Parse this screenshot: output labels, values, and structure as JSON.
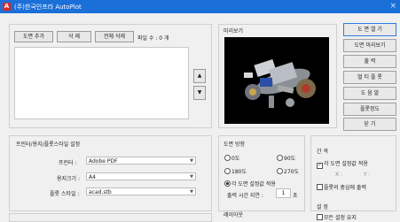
{
  "window": {
    "icon_glyph": "A",
    "title": "(주)한국인프라 AutoPlot",
    "close_glyph": "×"
  },
  "file_panel": {
    "add_label": "도면 추가",
    "delete_label": "삭 제",
    "delete_all_label": "전체 삭제",
    "file_count_label": "파일 수 : 0 개",
    "up_arrow": "▲",
    "down_arrow": "▼"
  },
  "preview": {
    "label": "미리보기"
  },
  "side_buttons": [
    {
      "label": "도 면 열 기"
    },
    {
      "label": "도면 미리보기"
    },
    {
      "label": "출  력"
    },
    {
      "label": "멀 티 플 롯"
    },
    {
      "label": "도 움 말"
    },
    {
      "label": "플롯정도"
    },
    {
      "label": "닫  기"
    }
  ],
  "printer_group": {
    "title": "프린터/용지/플롯스타일 설정",
    "printer_label": "프린터 :",
    "printer_value": "Adobe PDF",
    "paper_label": "용지크기 :",
    "paper_value": "A4",
    "style_label": "플롯 스타일 :",
    "style_value": "acad.stb"
  },
  "direction_group": {
    "title": "도면 방향",
    "opt_0": "0도",
    "opt_90": "90도",
    "opt_180": "180도",
    "opt_270": "270도",
    "opt_auto": "각 도면 설정값 적용",
    "delay_label": "출력 시간 지연 :",
    "delay_value": "1",
    "delay_unit": "초",
    "layout_label": "레이아웃"
  },
  "spacing_group": {
    "title": "간 격",
    "apply_label": "각 도면 설정값 적용",
    "x_label": "X :",
    "y_label": "Y :",
    "center_label": "플롯의 중심에 출력",
    "settings_label": "설 정",
    "settings_sub": "모든 설정 유지"
  }
}
